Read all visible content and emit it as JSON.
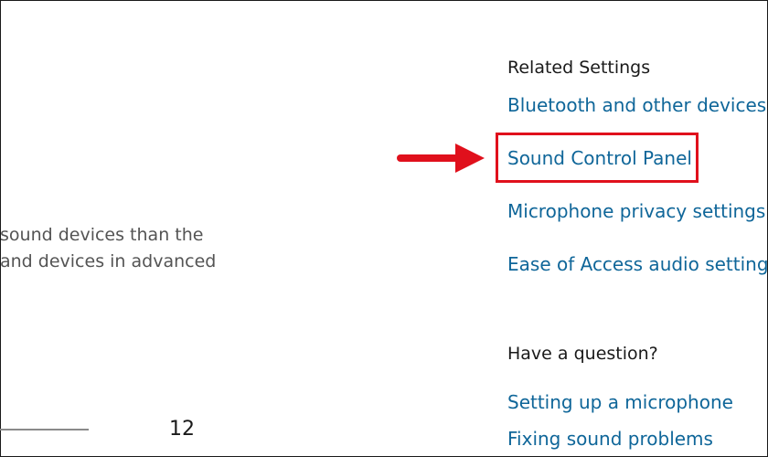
{
  "description_text": {
    "line1": "sound devices than the",
    "line2": "and devices in advanced"
  },
  "slider": {
    "value": "12"
  },
  "related_settings": {
    "heading": "Related Settings",
    "links": [
      "Bluetooth and other devices",
      "Sound Control Panel",
      "Microphone privacy settings",
      "Ease of Access audio settings"
    ]
  },
  "help": {
    "heading": "Have a question?",
    "links": [
      "Setting up a microphone",
      "Fixing sound problems"
    ]
  },
  "colors": {
    "link": "#0f6699",
    "highlight": "#e0101c",
    "text": "#1a1a1a",
    "muted_text": "#545454"
  }
}
